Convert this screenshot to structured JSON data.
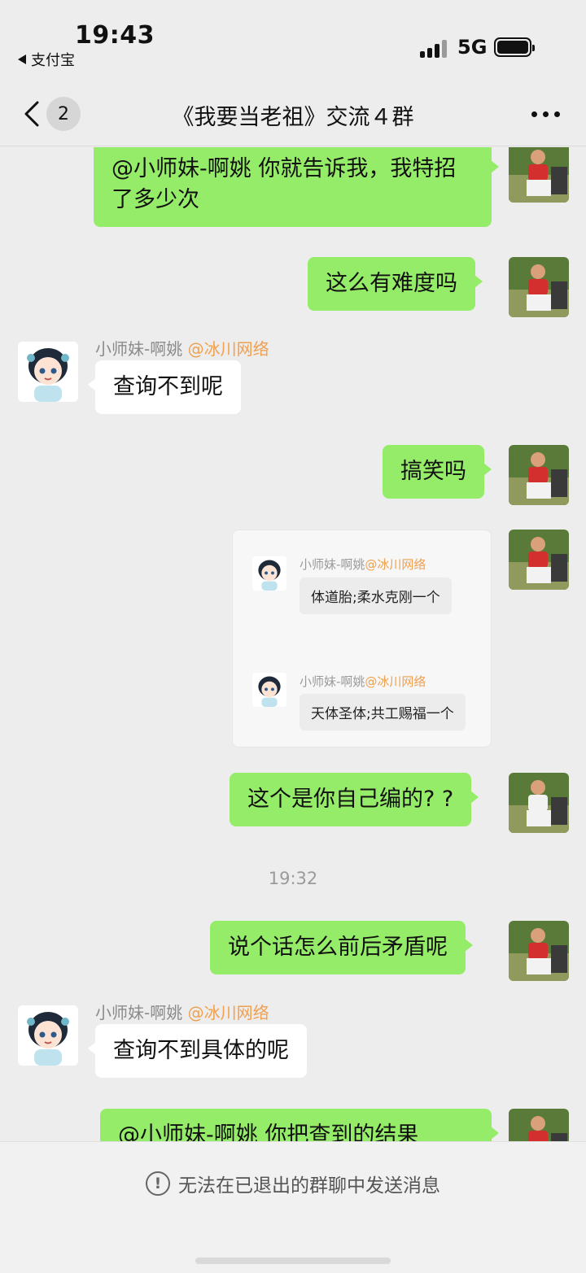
{
  "status": {
    "time": "19:43",
    "back_app": "支付宝",
    "network": "5G"
  },
  "nav": {
    "unread_count": "2",
    "title": "《我要当老祖》交流４群"
  },
  "messages": {
    "m1": "@小师妹-啊姚 你就告诉我，我特招了多少次",
    "m2": "这么有难度吗",
    "m3_sender": "小师妹-啊姚",
    "m3_mention": "@冰川网络",
    "m3": "查询不到呢",
    "m4": "搞笑吗",
    "m5": "这个是你自己编的? ?",
    "timestamp": "19:32",
    "m6": "说个话怎么前后矛盾呢",
    "m7_sender": "小师妹-啊姚",
    "m7_mention": "@冰川网络",
    "m7": "查询不到具体的呢",
    "m8": "@小师妹-啊姚 你把查到的结果"
  },
  "quote": {
    "items": [
      {
        "name": "小师妹-啊姚",
        "mention": "@冰川网络",
        "text": "体道胎;柔水克刚一个"
      },
      {
        "name": "小师妹-啊姚",
        "mention": "@冰川网络",
        "text": "天体圣体;共工赐福一个"
      }
    ]
  },
  "footer": {
    "notice": "无法在已退出的群聊中发送消息"
  }
}
